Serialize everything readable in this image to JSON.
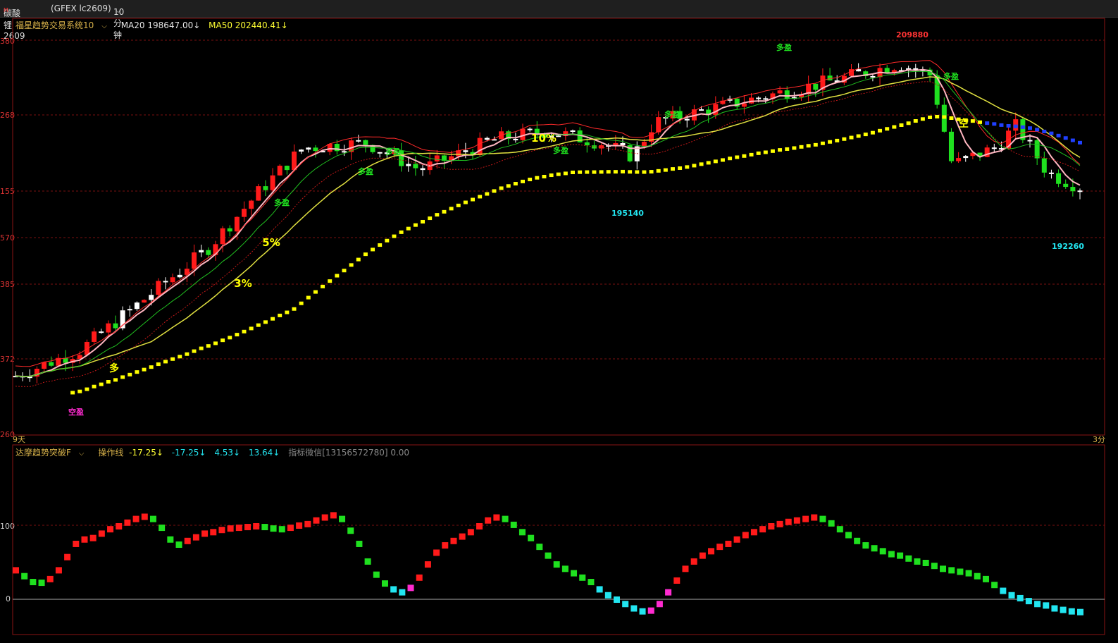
{
  "header": {
    "symbol": "碳酸锂2609",
    "marker": "M",
    "exchange": "(GFEX  lc2609)",
    "period": "10分钟"
  },
  "main_legend": {
    "system": "福星趋势交易系统10",
    "ma20": "MA20 198647.00↓",
    "ma50": "MA50 202440.41↓"
  },
  "sub_legend": {
    "name": "达摩趋势突破F",
    "op": "操作线",
    "v1": "-17.25↓",
    "v2": "-17.25↓",
    "v3": "4.53↓",
    "v4": "13.64↓",
    "note": "指标微信[13156572780] 0.00"
  },
  "price_axis": [
    "380",
    "268",
    "155",
    "570",
    "385",
    "372",
    "260"
  ],
  "sub_axis": [
    "100",
    "0"
  ],
  "bottom_left": "9天",
  "bottom_right": "3分",
  "colors": {
    "up": "#ff1a1a",
    "down": "#1fe01f",
    "white": "#ffffff",
    "ma_slow": "#ffff00",
    "cyan": "#22e5f0",
    "magenta": "#ff2bd0",
    "grid": "#7a1010"
  },
  "chart_data": [
    {
      "type": "candlestick",
      "title": "",
      "annotations": [
        {
          "text": "多",
          "x": 40
        },
        {
          "text": "空盈",
          "x": 23
        },
        {
          "text": "3%",
          "x": 80
        },
        {
          "text": "5%",
          "x": 91
        },
        {
          "text": "多盈",
          "x": 94
        },
        {
          "text": "多盈",
          "x": 122
        },
        {
          "text": "多盈",
          "x": 132
        },
        {
          "text": "10%",
          "x": 187
        },
        {
          "text": "多盈",
          "x": 195
        },
        {
          "text": "195140",
          "x": 221
        },
        {
          "text": "多盈",
          "x": 236
        },
        {
          "text": "多盈",
          "x": 276
        },
        {
          "text": "209880",
          "x": 323
        },
        {
          "text": "多盈",
          "x": 336
        },
        {
          "text": "空",
          "x": 341
        },
        {
          "text": "192260",
          "x": 374
        }
      ],
      "close": [
        195300,
        195380,
        195450,
        195520,
        195600,
        195650,
        195700,
        195760,
        195820,
        195900,
        196000,
        196100,
        196250,
        196400,
        196700,
        197100,
        197500,
        197900,
        198200,
        198300,
        198200,
        198450,
        198700,
        198950,
        199150,
        199400,
        199600,
        199850,
        200100,
        200300,
        200500,
        200700,
        200800,
        200750,
        200650,
        200550,
        200400,
        200300,
        200500,
        200700,
        201000,
        201300,
        201600,
        201900,
        202200,
        202500,
        202700,
        202850,
        203000,
        203100,
        203150,
        203200,
        203250,
        203300,
        203350,
        203300,
        203200,
        203100,
        203000,
        202900,
        202850,
        202800,
        202750,
        202700,
        202650,
        202600,
        202700,
        202850,
        203050,
        203250,
        203450,
        203650,
        203800,
        203950,
        204100,
        204250,
        204400,
        204500,
        204600,
        204700,
        204750,
        204800,
        204850,
        204900,
        204950,
        205000,
        205100,
        205200,
        205300,
        205400,
        205500,
        205600,
        205700,
        205800,
        205900,
        206000,
        206100,
        206200,
        206300,
        206400,
        206350,
        206300,
        206250,
        206200,
        206150,
        206100,
        206050,
        206000,
        205950,
        205900,
        205850,
        205800,
        205750,
        205700,
        205650,
        205600,
        205550,
        205500,
        205450,
        205400,
        205350,
        205300,
        205250,
        205200,
        205150,
        205100,
        205050,
        205000,
        204950,
        204900,
        204850,
        204800,
        204750,
        204700,
        204650,
        204600,
        204550,
        204500,
        204450,
        204400,
        204350,
        204300,
        204250,
        204200,
        204150,
        204100,
        204050,
        204000,
        203950,
        203900,
        203850,
        203800,
        203750,
        203700,
        203650,
        203600,
        203550,
        203500,
        203450,
        203400,
        203350,
        203300,
        203250,
        203200,
        203150,
        203100,
        203050,
        203000,
        202950,
        202900,
        202850,
        202800,
        202750,
        202700,
        202650,
        202600,
        202550,
        202500,
        202450,
        202400,
        202350,
        202300,
        202250,
        202200,
        202150,
        202100,
        202050,
        202000,
        201950,
        201900,
        201850,
        201800,
        201750,
        201700,
        201650,
        201600,
        201550,
        201500,
        201450,
        201400,
        201350,
        201300,
        201250,
        201200,
        201150,
        201100,
        201050,
        201000,
        200950,
        200900,
        200850,
        200800,
        200750,
        200700,
        200650,
        200600,
        200550,
        200500,
        200450,
        200400,
        200350,
        200300,
        200250,
        200200,
        200150,
        200100,
        200050,
        200000,
        199950,
        199900,
        199850,
        199800,
        199750,
        199700,
        199650,
        199600,
        199550,
        199500,
        199450,
        199400,
        199350,
        199300,
        199250,
        199200,
        199150,
        199100,
        199050,
        199000,
        198950,
        198900,
        198850,
        198800,
        198750,
        198700,
        198650,
        198600,
        198550,
        198500,
        198450,
        198400,
        198350,
        198300,
        198250,
        198200,
        198150,
        198100,
        198050,
        198000,
        197950,
        197900,
        197850,
        197800,
        197750,
        197700,
        197650,
        197600,
        197550,
        197500,
        197450,
        197400,
        197350,
        197300,
        197250,
        197200,
        197150,
        197100,
        197050,
        197000,
        196950,
        196900,
        196850,
        196800,
        196750,
        196700,
        196650,
        196600,
        196550,
        196500,
        196450,
        196400,
        196350,
        196300,
        196250,
        196200,
        196150,
        196100,
        196050,
        196000,
        195950,
        195900,
        195850,
        195800,
        195750,
        195700,
        195650,
        195600,
        195550,
        195500,
        195450,
        195400,
        195350,
        195300,
        195250,
        195200,
        195150,
        195100,
        195050,
        195000,
        194950,
        194900,
        194850,
        194800,
        194750,
        194700,
        194650,
        194600,
        194550,
        194500,
        194450,
        194400,
        194350,
        194300,
        194250,
        194200,
        194150,
        194100,
        194050,
        194000,
        193950,
        193900,
        193850,
        193800,
        193750,
        193700,
        193650,
        193600,
        193550,
        193500,
        193450,
        193400,
        193350,
        193300,
        193250,
        193200,
        193150,
        193100,
        193050,
        193000,
        192950,
        192900,
        192850,
        192800,
        192750,
        192700,
        192650,
        192600
      ]
    },
    {
      "type": "line",
      "title": "达摩趋势突破F",
      "y_labels": [
        "100",
        "0"
      ],
      "series": [
        {
          "name": "操作线",
          "values": [
            40,
            32,
            24,
            23,
            28,
            40,
            58,
            76,
            82,
            84,
            90,
            96,
            100,
            105,
            110,
            113,
            110,
            98,
            82,
            75,
            80,
            85,
            90,
            92,
            95,
            97,
            98,
            99,
            100,
            99,
            97,
            96,
            98,
            101,
            103,
            108,
            112,
            115,
            110,
            94,
            76,
            52,
            34,
            22,
            14,
            10,
            16,
            30,
            48,
            64,
            74,
            80,
            86,
            92,
            100,
            108,
            112,
            110,
            102,
            92,
            84,
            72,
            60,
            48,
            42,
            36,
            30,
            24,
            14,
            6,
            0,
            -6,
            -12,
            -16,
            -15,
            -6,
            10,
            26,
            42,
            52,
            60,
            66,
            72,
            76,
            82,
            88,
            92,
            96,
            100,
            103,
            106,
            108,
            110,
            112,
            110,
            104,
            96,
            88,
            80,
            74,
            70,
            66,
            62,
            60,
            56,
            52,
            50,
            46,
            42,
            40,
            38,
            36,
            32,
            28,
            20,
            12,
            6,
            2,
            -2,
            -6,
            -8,
            -12,
            -14,
            -16,
            -17
          ]
        }
      ]
    }
  ]
}
